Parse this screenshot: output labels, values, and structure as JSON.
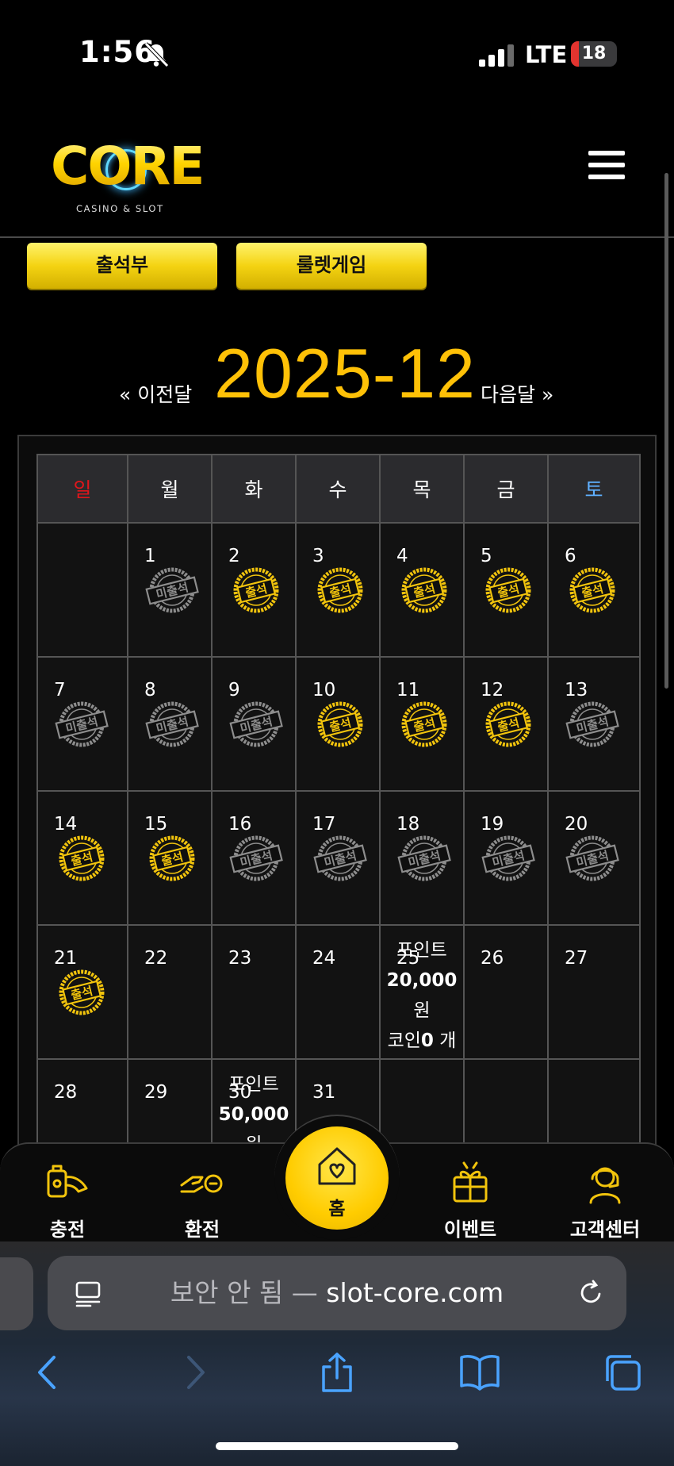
{
  "status_bar": {
    "time": "1:56",
    "network": "LTE",
    "battery": "18",
    "battery_level": 0.18
  },
  "header": {
    "logo_text": "CORE",
    "logo_subtitle": "CASINO & SLOT"
  },
  "buttons": {
    "attendance": "출석부",
    "roulette": "룰렛게임"
  },
  "calendar": {
    "prev": "« 이전달",
    "title": "2025-12",
    "next": "다음달 »",
    "weekdays": [
      {
        "label": "일",
        "color": "#e0161b"
      },
      {
        "label": "월",
        "color": "#ffffff"
      },
      {
        "label": "화",
        "color": "#ffffff"
      },
      {
        "label": "수",
        "color": "#ffffff"
      },
      {
        "label": "목",
        "color": "#ffffff"
      },
      {
        "label": "금",
        "color": "#ffffff"
      },
      {
        "label": "토",
        "color": "#5fb0ff"
      }
    ],
    "stamp_texts": {
      "present": "출석",
      "absent": "미출석"
    },
    "colors": {
      "present": "#f2c40c",
      "absent": "#8d8d8d"
    },
    "weeks": [
      [
        {
          "day": ""
        },
        {
          "day": "1",
          "stamp": "absent"
        },
        {
          "day": "2",
          "stamp": "present"
        },
        {
          "day": "3",
          "stamp": "present"
        },
        {
          "day": "4",
          "stamp": "present"
        },
        {
          "day": "5",
          "stamp": "present"
        },
        {
          "day": "6",
          "stamp": "present"
        }
      ],
      [
        {
          "day": "7",
          "stamp": "absent"
        },
        {
          "day": "8",
          "stamp": "absent"
        },
        {
          "day": "9",
          "stamp": "absent"
        },
        {
          "day": "10",
          "stamp": "present"
        },
        {
          "day": "11",
          "stamp": "present"
        },
        {
          "day": "12",
          "stamp": "present"
        },
        {
          "day": "13",
          "stamp": "absent"
        }
      ],
      [
        {
          "day": "14",
          "stamp": "present"
        },
        {
          "day": "15",
          "stamp": "present"
        },
        {
          "day": "16",
          "stamp": "absent"
        },
        {
          "day": "17",
          "stamp": "absent"
        },
        {
          "day": "18",
          "stamp": "absent"
        },
        {
          "day": "19",
          "stamp": "absent"
        },
        {
          "day": "20",
          "stamp": "absent"
        }
      ],
      [
        {
          "day": "21",
          "stamp": "present"
        },
        {
          "day": "22"
        },
        {
          "day": "23"
        },
        {
          "day": "24"
        },
        {
          "day": "25",
          "reward": {
            "label": "포인트",
            "amount": "20,000",
            "unit": "원",
            "coin_prefix": "코인",
            "coin_count": "0",
            "coin_unit": "개"
          }
        },
        {
          "day": "26"
        },
        {
          "day": "27"
        }
      ],
      [
        {
          "day": "28"
        },
        {
          "day": "29"
        },
        {
          "day": "30",
          "reward": {
            "label": "포인트",
            "amount": "50,000",
            "unit": "원"
          }
        },
        {
          "day": "31"
        },
        {
          "day": ""
        },
        {
          "day": ""
        },
        {
          "day": ""
        }
      ]
    ]
  },
  "bottom_nav": {
    "deposit": "충전",
    "withdraw": "환전",
    "home": "홈",
    "event": "이벤트",
    "support": "고객센터"
  },
  "browser": {
    "url_prefix": "보안 안 됨 — ",
    "url_domain": "slot-core.com"
  }
}
